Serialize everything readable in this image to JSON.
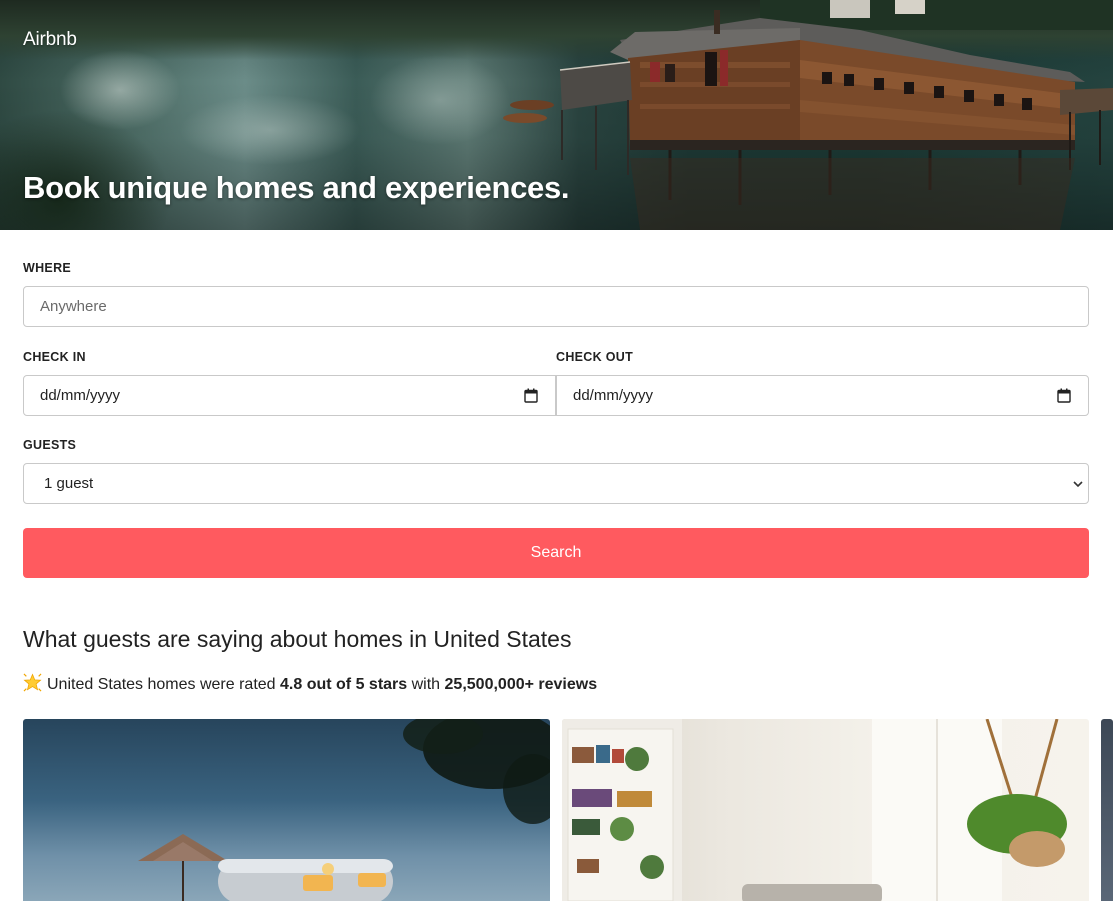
{
  "header": {
    "brand": "Airbnb",
    "headline": "Book unique homes and experiences."
  },
  "search_form": {
    "where": {
      "label": "WHERE",
      "placeholder": "Anywhere"
    },
    "check_in": {
      "label": "CHECK IN",
      "placeholder": "dd/mm/yyyy"
    },
    "check_out": {
      "label": "CHECK OUT",
      "placeholder": "dd/mm/yyyy"
    },
    "guests": {
      "label": "GUESTS",
      "selected": "1 guest"
    },
    "submit_label": "Search"
  },
  "reviews": {
    "title": "What guests are saying about homes in United States",
    "summary_prefix": "United States homes were rated",
    "rating": "4.8 out of 5 stars",
    "connector": "with",
    "review_count": "25,500,000+ reviews"
  },
  "listings": [
    {
      "image": "airstream-trailer-at-dusk"
    },
    {
      "image": "bright-living-room-with-plants"
    },
    {
      "image": "partial-card"
    }
  ],
  "colors": {
    "accent": "#ff5a5f",
    "text": "#222222",
    "border": "#c9c9c9"
  },
  "icons": {
    "star": "glowing-star-icon",
    "calendar": "calendar-icon",
    "select": "chevron-down-icon"
  }
}
